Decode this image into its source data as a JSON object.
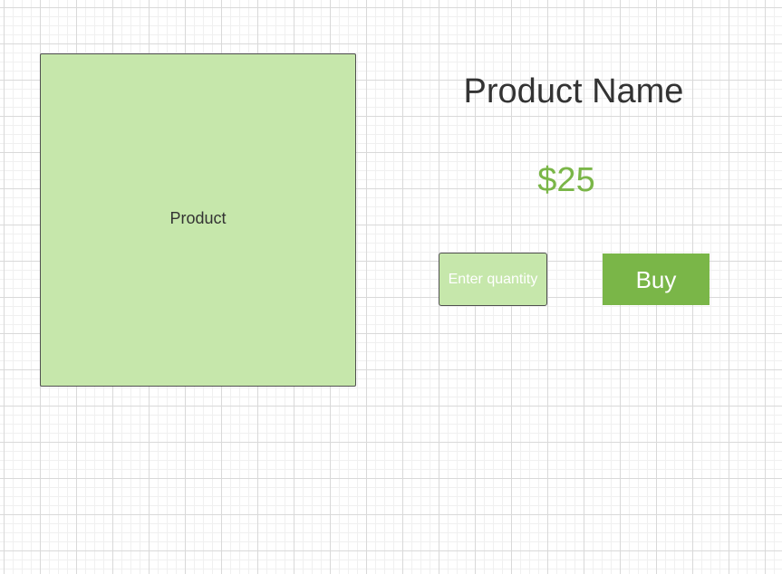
{
  "product": {
    "image_label": "Product",
    "name": "Product Name",
    "price": "$25"
  },
  "quantity": {
    "value": "",
    "placeholder": "Enter quantity"
  },
  "actions": {
    "buy_label": "Buy"
  },
  "colors": {
    "placeholder_fill": "#c6e7ab",
    "accent_green": "#7ab648",
    "text_dark": "#333333",
    "border": "#4f4f4f"
  }
}
